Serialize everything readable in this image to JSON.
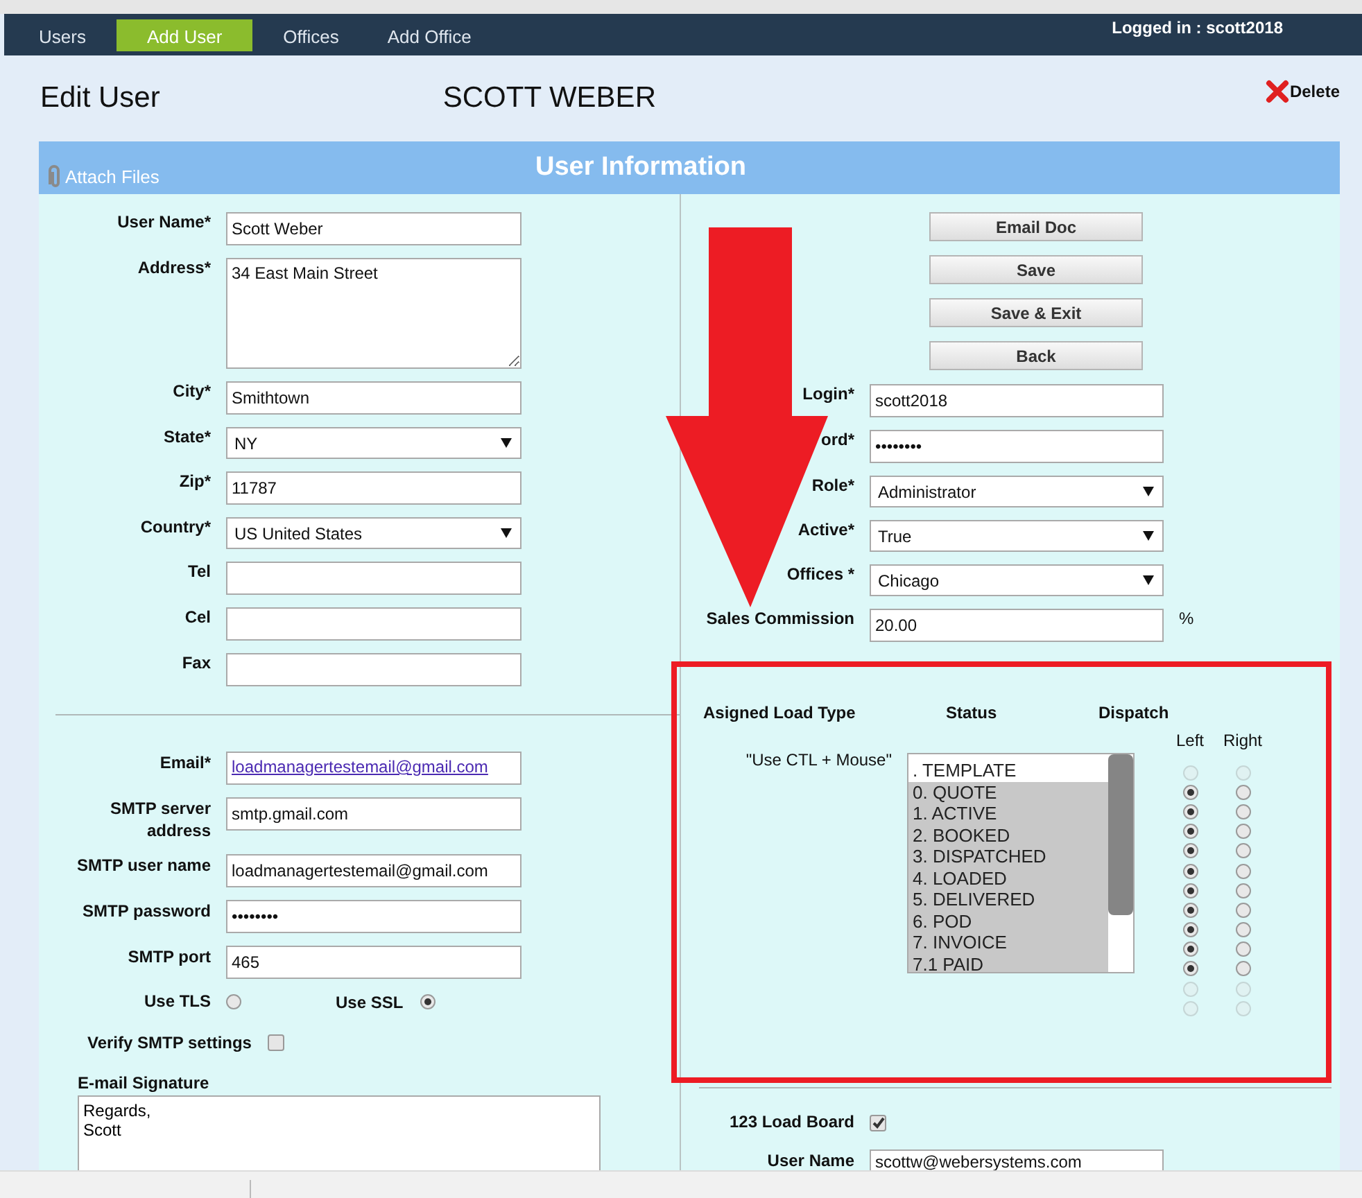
{
  "nav": {
    "tabs": [
      {
        "label": "Users",
        "selected": false
      },
      {
        "label": "Add User",
        "selected": true
      },
      {
        "label": "Offices",
        "selected": false
      },
      {
        "label": "Add Office",
        "selected": false
      }
    ],
    "logged_in": "Logged in : scott2018"
  },
  "header": {
    "title": "Edit User",
    "name": "SCOTT WEBER",
    "delete": "Delete"
  },
  "section": {
    "attach": "Attach Files",
    "title": "User Information"
  },
  "user_fields": [
    {
      "label": "User Name*",
      "kind": "text",
      "value": "Scott Weber"
    },
    {
      "label": "Address*",
      "kind": "textarea",
      "value": "34 East Main Street"
    },
    {
      "label": "City*",
      "kind": "text",
      "value": "Smithtown"
    },
    {
      "label": "State*",
      "kind": "select",
      "value": "NY"
    },
    {
      "label": "Zip*",
      "kind": "text",
      "value": "11787"
    },
    {
      "label": "Country*",
      "kind": "select",
      "value": "US United States"
    },
    {
      "label": "Tel",
      "kind": "text"
    },
    {
      "label": "Cel",
      "kind": "text"
    },
    {
      "label": "Fax",
      "kind": "text"
    }
  ],
  "mail_fields": [
    {
      "label": "Email*",
      "kind": "link",
      "value": "loadmanagertestemail@gmail.com"
    },
    {
      "label": "SMTP server address",
      "kind": "text",
      "value": "smtp.gmail.com"
    },
    {
      "label": "SMTP user name",
      "kind": "text",
      "value": "loadmanagertestemail@gmail.com"
    },
    {
      "label": "SMTP password",
      "kind": "text",
      "value": "••••••••"
    },
    {
      "label": "SMTP port",
      "kind": "text",
      "value": "465"
    }
  ],
  "tls": {
    "label": "Use TLS",
    "checked": false
  },
  "ssl": {
    "label": "Use SSL",
    "checked": true
  },
  "verify": {
    "label": "Verify SMTP settings",
    "checked": false
  },
  "signature": {
    "label": "E-mail Signature",
    "value": "Regards,\nScott"
  },
  "buttons": [
    "Email Doc",
    "Save",
    "Save & Exit",
    "Back"
  ],
  "account_fields": [
    {
      "label": "Login*",
      "kind": "text",
      "value": "scott2018"
    },
    {
      "label": "ord*",
      "kind": "text",
      "value": "••••••••"
    },
    {
      "label": "Role*",
      "kind": "select",
      "value": "Administrator"
    },
    {
      "label": "Active*",
      "kind": "select",
      "value": "True"
    },
    {
      "label": "Offices *",
      "kind": "select",
      "value": "Chicago"
    },
    {
      "label": "Sales Commission",
      "kind": "text",
      "value": "20.00",
      "unit": "%"
    }
  ],
  "load_types": {
    "headers": [
      "Asigned Load Type",
      "Status",
      "Dispatch"
    ],
    "hint": "\"Use CTL + Mouse\"",
    "statuses": [
      {
        "label": ". TEMPLATE",
        "selected": false
      },
      {
        "label": "0. QUOTE",
        "selected": true
      },
      {
        "label": "1. ACTIVE",
        "selected": true
      },
      {
        "label": "2. BOOKED",
        "selected": true
      },
      {
        "label": "3. DISPATCHED",
        "selected": true
      },
      {
        "label": "4. LOADED",
        "selected": true
      },
      {
        "label": "5. DELIVERED",
        "selected": true
      },
      {
        "label": "6. POD",
        "selected": true
      },
      {
        "label": "7. INVOICE",
        "selected": true
      },
      {
        "label": "7.1 PAID",
        "selected": true
      }
    ],
    "dispatch_columns": [
      "Left",
      "Right"
    ],
    "dispatch": [
      {
        "left": false,
        "right": false,
        "disabled": true
      },
      {
        "left": true,
        "right": false,
        "disabled": false
      },
      {
        "left": true,
        "right": false,
        "disabled": false
      },
      {
        "left": true,
        "right": false,
        "disabled": false
      },
      {
        "left": true,
        "right": false,
        "disabled": false
      },
      {
        "left": true,
        "right": false,
        "disabled": false
      },
      {
        "left": true,
        "right": false,
        "disabled": false
      },
      {
        "left": true,
        "right": false,
        "disabled": false
      },
      {
        "left": true,
        "right": false,
        "disabled": false
      },
      {
        "left": true,
        "right": false,
        "disabled": false
      },
      {
        "left": true,
        "right": false,
        "disabled": false
      },
      {
        "left": false,
        "right": false,
        "disabled": true
      },
      {
        "left": false,
        "right": false,
        "disabled": true
      }
    ]
  },
  "load_board": {
    "label": "123 Load Board",
    "checked": true
  },
  "board_user": {
    "label": "User Name",
    "value": "scottw@webersystems.com"
  }
}
